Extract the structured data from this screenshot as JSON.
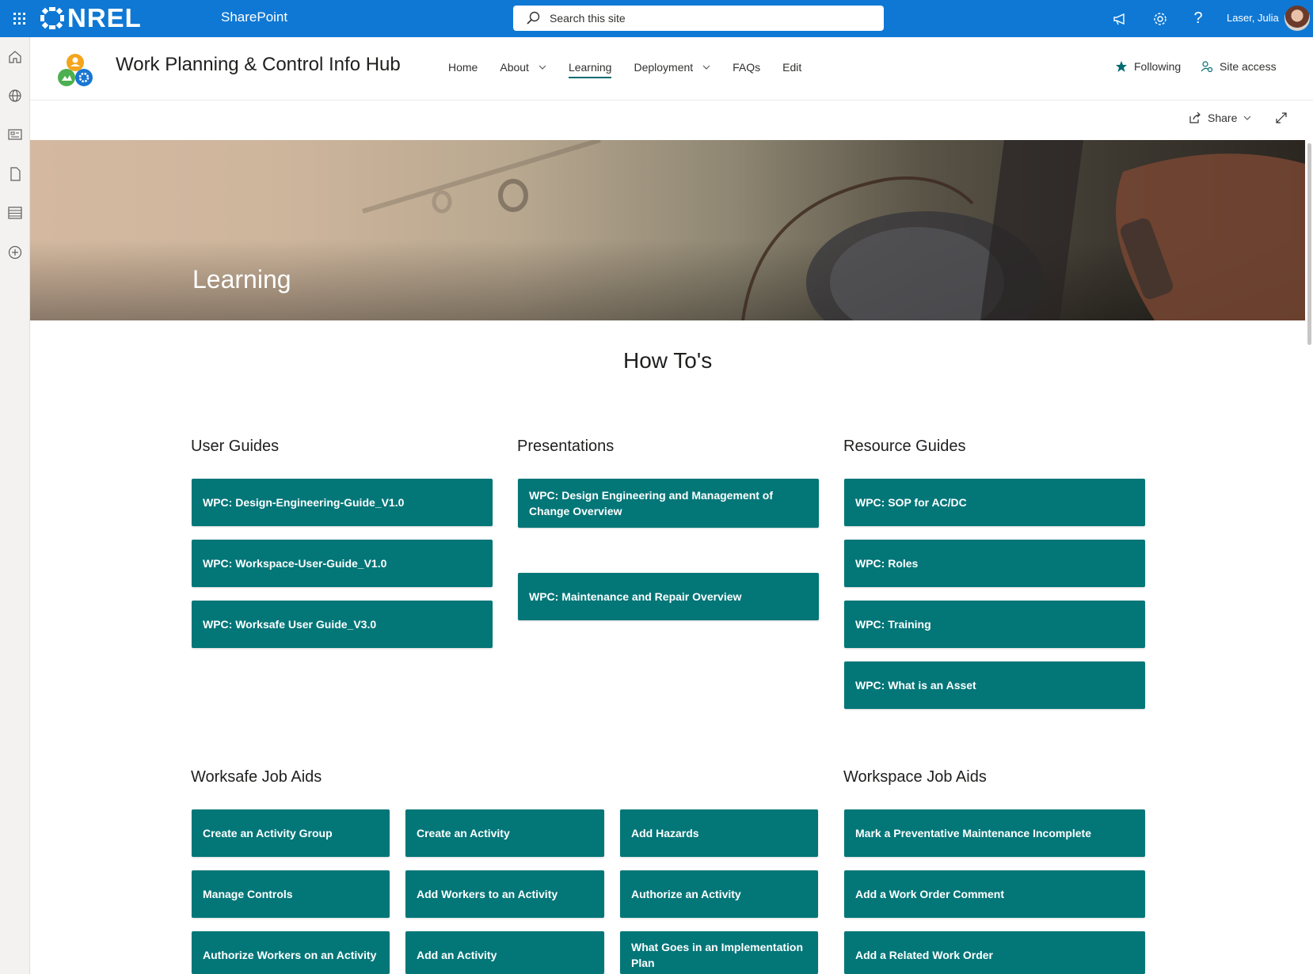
{
  "suitebar": {
    "org": "NREL",
    "app_name": "SharePoint",
    "search_placeholder": "Search this site",
    "user_name": "Laser, Julia"
  },
  "site": {
    "title": "Work Planning & Control Info Hub",
    "nav": [
      {
        "label": "Home"
      },
      {
        "label": "About"
      },
      {
        "label": "Learning"
      },
      {
        "label": "Deployment"
      },
      {
        "label": "FAQs"
      },
      {
        "label": "Edit"
      }
    ],
    "following_label": "Following",
    "site_access_label": "Site access"
  },
  "command_bar": {
    "share_label": "Share"
  },
  "hero": {
    "title": "Learning"
  },
  "page": {
    "section_title": "How To's",
    "user_guides": {
      "heading": "User Guides",
      "items": [
        "WPC: Design-Engineering-Guide_V1.0",
        "WPC: Workspace-User-Guide_V1.0",
        "WPC: Worksafe User Guide_V3.0"
      ]
    },
    "presentations": {
      "heading": "Presentations",
      "items": [
        "WPC: Design Engineering and Management of Change Overview",
        "WPC: Maintenance and Repair Overview"
      ]
    },
    "resource_guides": {
      "heading": "Resource Guides",
      "items": [
        "WPC: SOP for AC/DC",
        "WPC: Roles",
        "WPC: Training",
        "WPC: What is an Asset"
      ]
    },
    "worksafe_job_aids": {
      "heading": "Worksafe Job Aids",
      "items": [
        "Create an Activity Group",
        "Create an Activity",
        "Add Hazards",
        "Manage Controls",
        "Add Workers to an Activity",
        "Authorize an Activity",
        "Authorize Workers on an Activity",
        "Add an Activity",
        "What Goes in an Implementation Plan"
      ]
    },
    "workspace_job_aids": {
      "heading": "Workspace Job Aids",
      "items": [
        "Mark a Preventative Maintenance Incomplete",
        "Add a Work Order Comment",
        "Add a Related Work Order"
      ]
    }
  },
  "colors": {
    "suitebar": "#0f78d4",
    "tile": "#037678",
    "accent": "#036c70"
  }
}
